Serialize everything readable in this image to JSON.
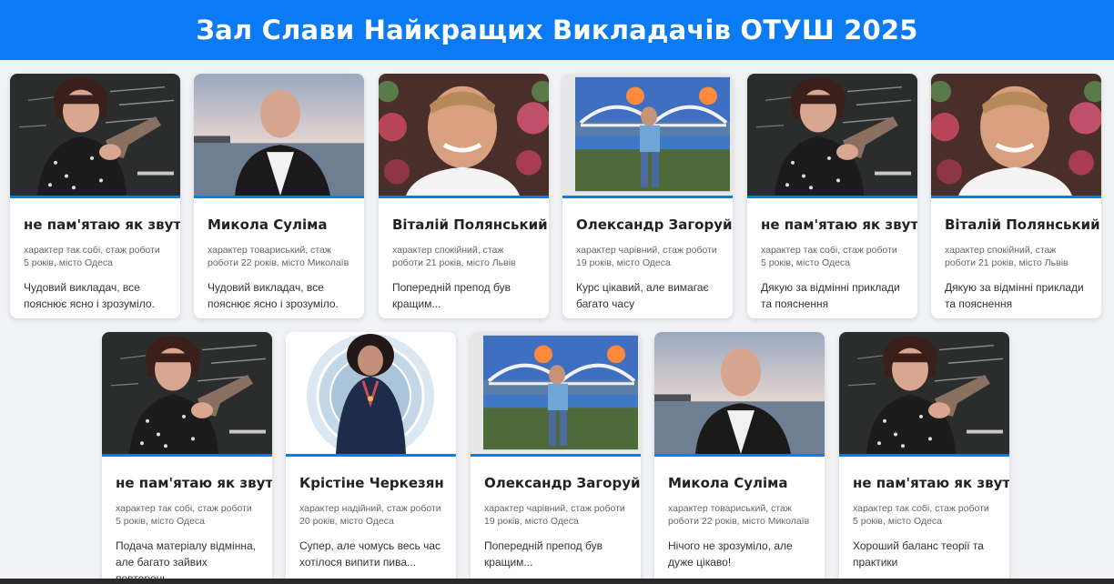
{
  "page": {
    "title": "Зал Слави Найкращих Викладачів ОТУШ 2025",
    "accent_color": "#0a7bf5",
    "background_color": "#f0f2f5"
  },
  "cards": [
    {
      "name": "не пам'ятаю як звуть",
      "meta": "характер так собі, стаж роботи 5 років, місто Одеса",
      "review": "Чудовий викладач, все пояснює ясно і зрозуміло.",
      "photo": "woman-with-gun-chalkboard"
    },
    {
      "name": "Микола Суліма",
      "meta": "характер товариський, стаж роботи 22 років, місто Миколаїв",
      "review": "Чудовий викладач, все пояснює ясно і зрозуміло.",
      "photo": "man-at-sea"
    },
    {
      "name": "Віталій Полянський",
      "meta": "характер спокійний, стаж роботи 21 років, місто Львів",
      "review": "Попередній препод був кращим...",
      "photo": "man-smiling-flowers"
    },
    {
      "name": "Олександр Загоруйко",
      "meta": "характер чарівний, стаж роботи 19 років, місто Одеса",
      "review": "Курс цікавий, але вимагає багато часу",
      "photo": "man-stamp-bridge"
    },
    {
      "name": "не пам'ятаю як звуть",
      "meta": "характер так собі, стаж роботи 5 років, місто Одеса",
      "review": "Дякую за відмінні приклади та пояснення",
      "photo": "woman-with-gun-chalkboard"
    },
    {
      "name": "Віталій Полянський",
      "meta": "характер спокійний, стаж роботи 21 років, місто Львів",
      "review": "Дякую за відмінні приклади та пояснення",
      "photo": "man-smiling-flowers"
    },
    {
      "name": "не пам'ятаю як звуть",
      "meta": "характер так собі, стаж роботи 5 років, місто Одеса",
      "review": "Подача матеріалу відмінна, але багато зайвих повторень",
      "photo": "woman-with-gun-chalkboard"
    },
    {
      "name": "Крістіне Черкезян",
      "meta": "характер надійний, стаж роботи 20 років, місто Одеса",
      "review": "Супер, але чомусь весь час хотілося випити пива...",
      "photo": "woman-illustration-circle"
    },
    {
      "name": "Олександр Загоруйко",
      "meta": "характер чарівний, стаж роботи 19 років, місто Одеса",
      "review": "Попередній препод був кращим...",
      "photo": "man-stamp-bridge"
    },
    {
      "name": "Микола Суліма",
      "meta": "характер товариський, стаж роботи 22 років, місто Миколаїв",
      "review": "Нічого не зрозуміло, але дуже цікаво!",
      "photo": "man-at-sea"
    },
    {
      "name": "не пам'ятаю як звуть",
      "meta": "характер так собі, стаж роботи 5 років, місто Одеса",
      "review": "Хороший баланс теорії та практики",
      "photo": "woman-with-gun-chalkboard"
    }
  ]
}
